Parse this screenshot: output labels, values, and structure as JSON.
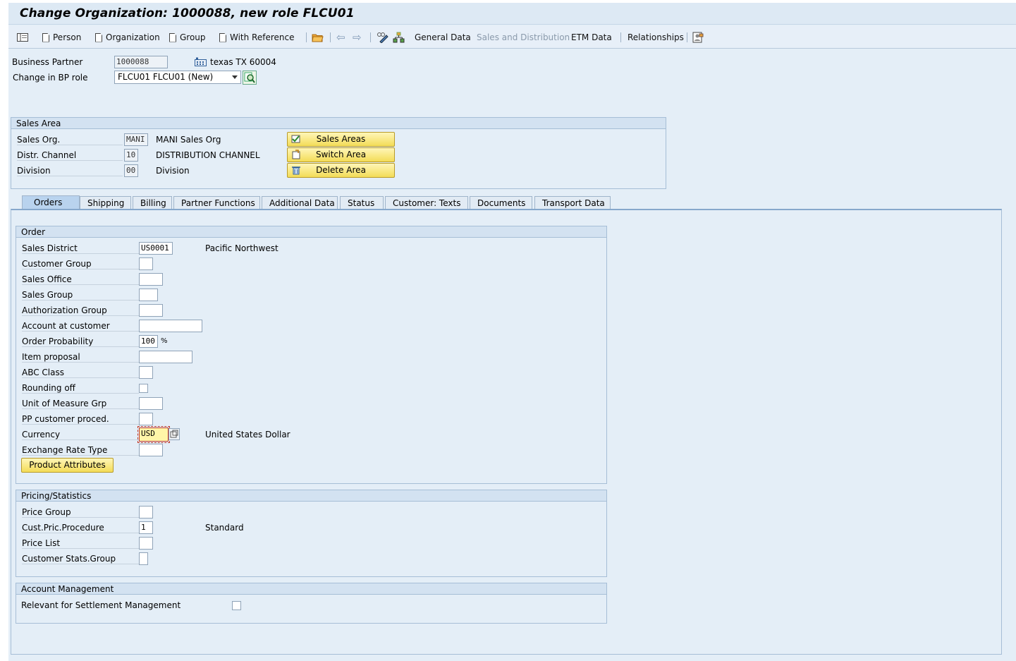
{
  "window": {
    "title": "Change Organization: 1000088, new role FLCU01"
  },
  "toolbar": {
    "person": "Person",
    "organization": "Organization",
    "group": "Group",
    "with_reference": "With Reference",
    "general_data": "General Data",
    "sales_distribution": "Sales and Distribution",
    "etm_data": "ETM Data",
    "relationships": "Relationships"
  },
  "header": {
    "bp_label": "Business Partner",
    "bp_value": "1000088",
    "bp_desc": "texas TX 60004",
    "role_label": "Change in BP role",
    "role_value": "FLCU01 FLCU01 (New)"
  },
  "sales_area": {
    "title": "Sales Area",
    "rows": [
      {
        "label": "Sales Org.",
        "value": "MANI",
        "desc": "MANI Sales Org"
      },
      {
        "label": "Distr. Channel",
        "value": "10",
        "desc": "DISTRIBUTION CHANNEL"
      },
      {
        "label": "Division",
        "value": "00",
        "desc": "Division"
      }
    ],
    "buttons": {
      "sales_areas": "Sales Areas",
      "switch_area": "Switch Area",
      "delete_area": "Delete Area"
    }
  },
  "tabs": [
    "Orders",
    "Shipping",
    "Billing",
    "Partner Functions",
    "Additional Data",
    "Status",
    "Customer: Texts",
    "Documents",
    "Transport Data"
  ],
  "order": {
    "title": "Order",
    "sales_district": {
      "label": "Sales District",
      "value": "US0001",
      "desc": "Pacific Northwest"
    },
    "customer_group": "Customer Group",
    "sales_office": "Sales Office",
    "sales_group": "Sales Group",
    "authorization_group": "Authorization Group",
    "account_at_customer": "Account at customer",
    "order_probability": {
      "label": "Order Probability",
      "value": "100",
      "unit": "%"
    },
    "item_proposal": "Item proposal",
    "abc_class": "ABC Class",
    "rounding_off": "Rounding off",
    "uom_grp": "Unit of Measure Grp",
    "pp_customer_proced": "PP customer proced.",
    "currency": {
      "label": "Currency",
      "value": "USD",
      "desc": "United States Dollar"
    },
    "exchange_rate_type": "Exchange Rate Type",
    "product_attributes": "Product Attributes"
  },
  "pricing": {
    "title": "Pricing/Statistics",
    "price_group": "Price Group",
    "cust_pric_procedure": {
      "label": "Cust.Pric.Procedure",
      "value": "1",
      "desc": "Standard"
    },
    "price_list": "Price List",
    "customer_stats_group": "Customer Stats.Group"
  },
  "account_mgmt": {
    "title": "Account Management",
    "settlement": "Relevant for Settlement Management"
  },
  "colors": {
    "accent_yellow": "#f3dc57",
    "frame": "#e4eef7",
    "header": "#d3e2f1"
  }
}
